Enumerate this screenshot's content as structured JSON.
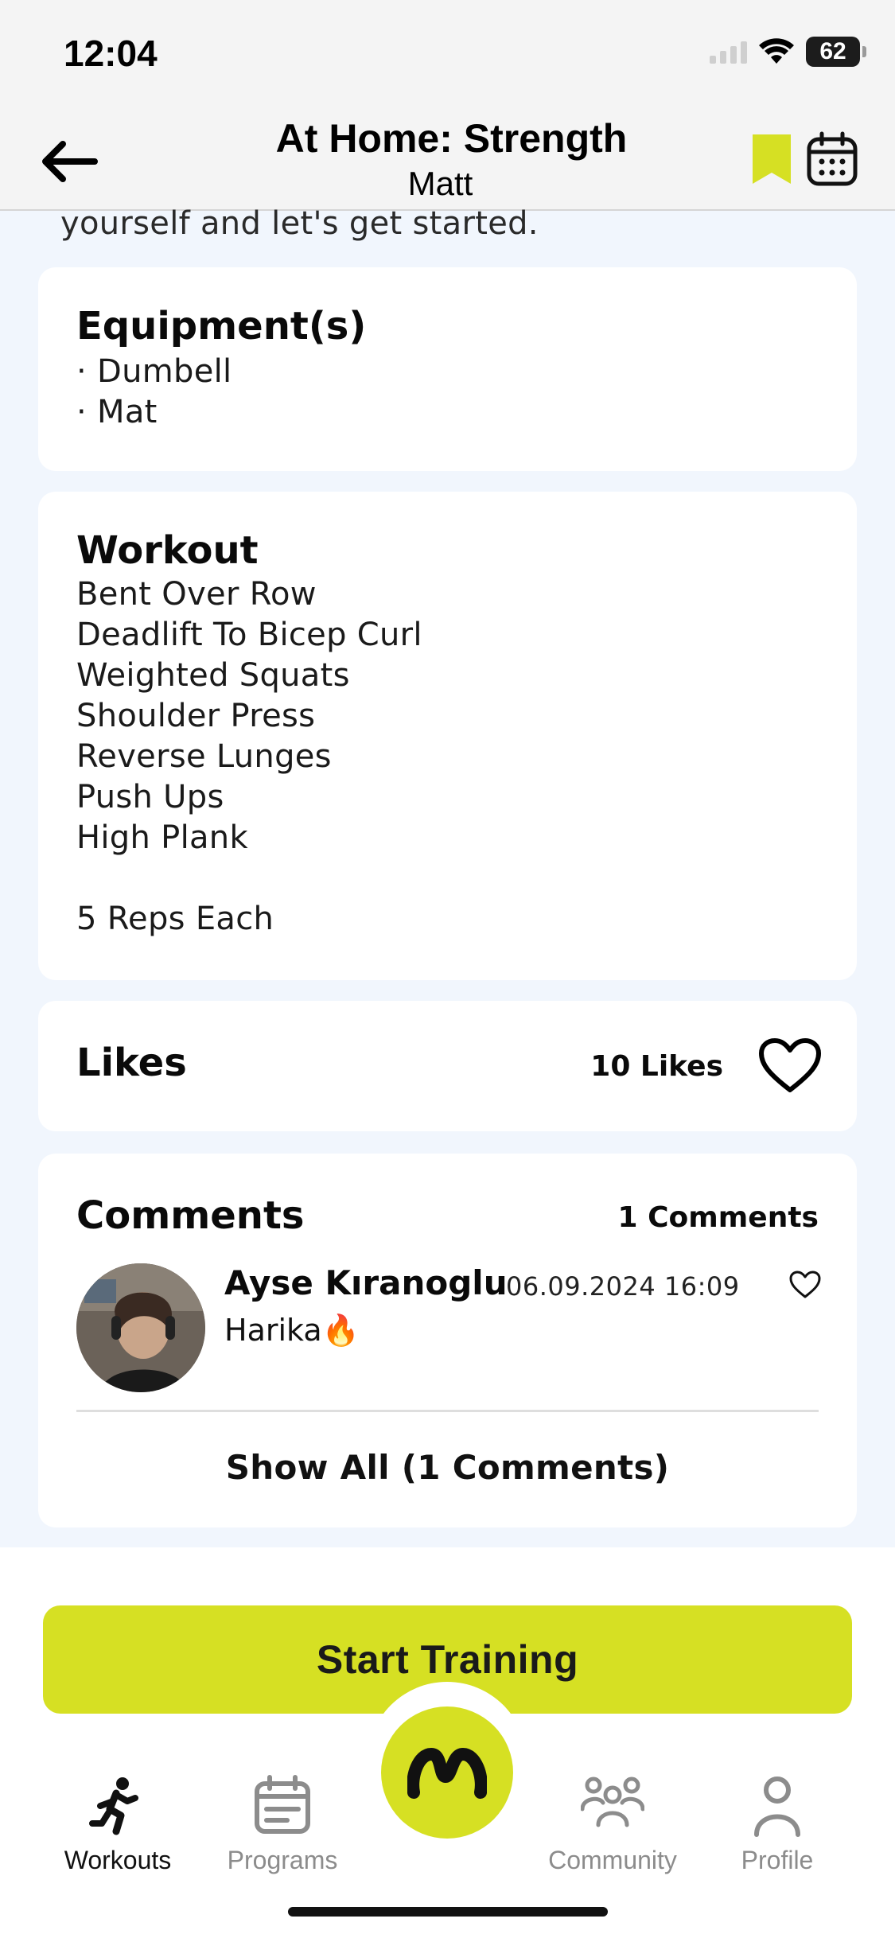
{
  "status_bar": {
    "time": "12:04",
    "battery": "62"
  },
  "header": {
    "title": "At Home: Strength",
    "subtitle": "Matt"
  },
  "description_tail": "yourself and let's get started.",
  "equipment": {
    "title": "Equipment(s)",
    "items": [
      "· Dumbell",
      "· Mat"
    ]
  },
  "workout": {
    "title": "Workout",
    "exercises": [
      "Bent Over Row",
      "Deadlift To Bicep Curl",
      "Weighted Squats",
      "Shoulder Press",
      "Reverse Lunges",
      "Push Ups",
      "High Plank"
    ],
    "reps_note": "5 Reps Each"
  },
  "likes": {
    "title": "Likes",
    "count_label": "10 Likes"
  },
  "comments": {
    "title": "Comments",
    "count_label": "1 Comments",
    "items": [
      {
        "author": "Ayse Kıranoglu",
        "date": "06.09.2024 16:09",
        "text": "Harika🔥"
      }
    ],
    "show_all_label": "Show All (1 Comments)"
  },
  "start_button_label": "Start Training",
  "tabs": [
    {
      "label": "Workouts",
      "icon": "running-person-icon",
      "active": true
    },
    {
      "label": "Programs",
      "icon": "calendar-list-icon",
      "active": false
    },
    {
      "label": "",
      "icon": "app-logo-icon",
      "active": false
    },
    {
      "label": "Community",
      "icon": "group-icon",
      "active": false
    },
    {
      "label": "Profile",
      "icon": "person-icon",
      "active": false
    }
  ],
  "colors": {
    "accent": "#d6e023",
    "background": "#f1f6fd",
    "card": "#ffffff",
    "text": "#0a0a0a",
    "inactive_tab": "#8c8c8c"
  }
}
